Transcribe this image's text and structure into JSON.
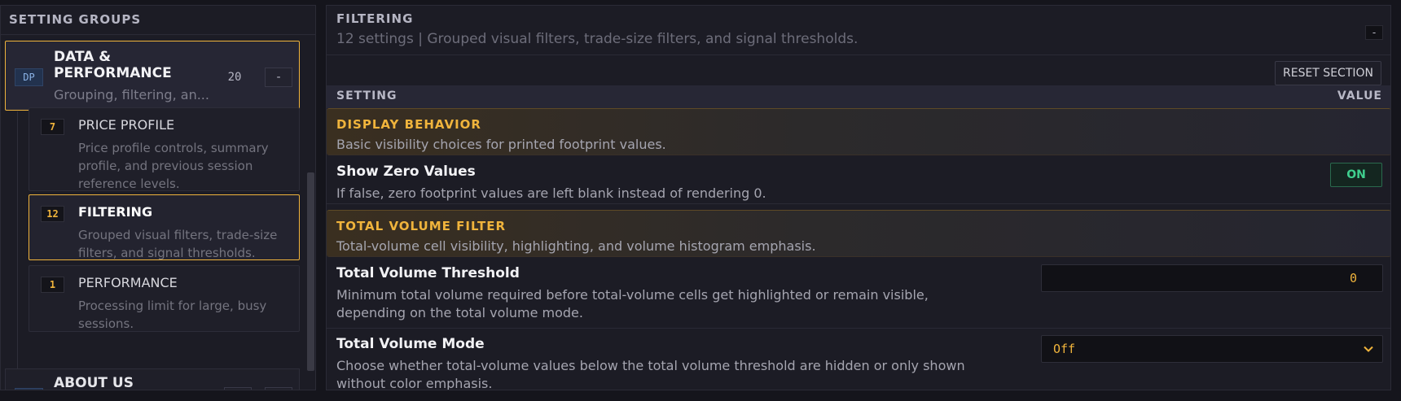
{
  "left": {
    "header": "SETTING GROUPS",
    "group": {
      "badge": "DP",
      "title": "DATA & PERFORMANCE",
      "desc": "Grouping, filtering, an...",
      "count": "20",
      "collapse": "-"
    },
    "items": [
      {
        "num": "7",
        "title": "PRICE PROFILE",
        "desc": "Price profile controls, summary profile, and previous session reference levels."
      },
      {
        "num": "12",
        "title": "FILTERING",
        "desc": "Grouped visual filters, trade-size filters, and signal thresholds."
      },
      {
        "num": "1",
        "title": "PERFORMANCE",
        "desc": "Processing limit for large, busy sessions."
      }
    ],
    "about": {
      "title": "ABOUT US"
    }
  },
  "section": {
    "title": "FILTERING",
    "summary": "12 settings | Grouped visual filters, trade-size filters, and signal thresholds.",
    "collapse": "-",
    "reset": "RESET SECTION",
    "col_setting": "SETTING",
    "col_value": "VALUE"
  },
  "categories": [
    {
      "title": "DISPLAY BEHAVIOR",
      "desc": "Basic visibility choices for printed footprint values."
    },
    {
      "title": "TOTAL VOLUME FILTER",
      "desc": "Total-volume cell visibility, highlighting, and volume histogram emphasis."
    }
  ],
  "settings": [
    {
      "title": "Show Zero Values",
      "desc": "If false, zero footprint values are left blank instead of rendering 0.",
      "value": "ON"
    },
    {
      "title": "Total Volume Threshold",
      "desc": "Minimum total volume required before total-volume cells get highlighted or remain visible, depending on the total volume mode.",
      "value": "0"
    },
    {
      "title": "Total Volume Mode",
      "desc": "Choose whether total-volume values below the total volume threshold are hidden or only shown without color emphasis.",
      "value": "Off"
    }
  ],
  "colors": {
    "accent": "#f0b43c",
    "on": "#3fcf8e",
    "panel": "#1c1c25"
  }
}
